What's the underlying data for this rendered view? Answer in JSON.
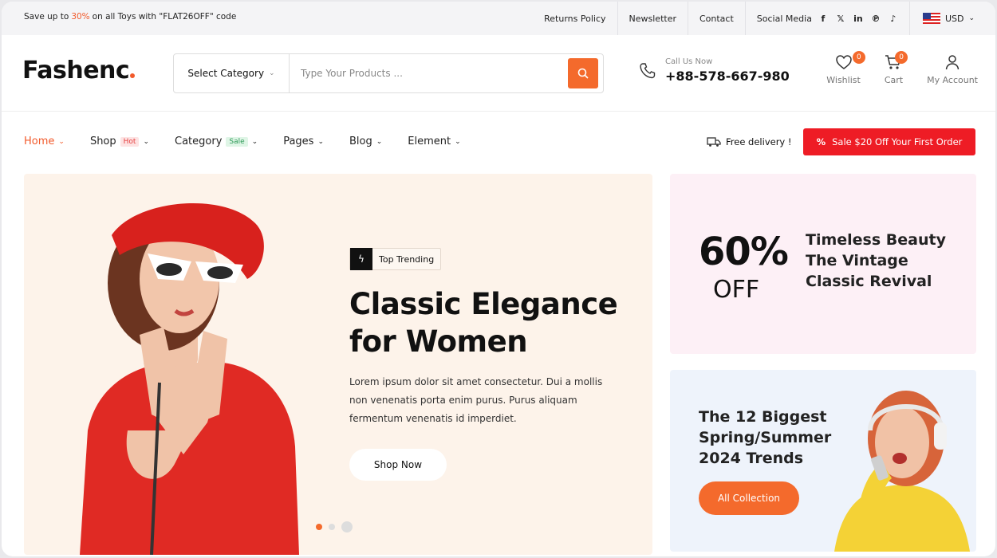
{
  "topbar": {
    "promo_before": "Save up to",
    "promo_pct": "30%",
    "promo_after": "on all Toys with \"FLAT26OFF\" code",
    "links": [
      "Returns Policy",
      "Newsletter",
      "Contact"
    ],
    "social_label": "Social Media",
    "social_icons": [
      "facebook-icon",
      "x-icon",
      "linkedin-icon",
      "pinterest-icon",
      "tiktok-icon"
    ],
    "currency": "USD"
  },
  "header": {
    "logo": "Fashenc",
    "category_label": "Select Category",
    "search_placeholder": "Type Your Products ...",
    "call_label": "Call Us Now",
    "call_number": "+88-578-667-980",
    "wishlist_label": "Wishlist",
    "wishlist_count": "0",
    "cart_label": "Cart",
    "cart_count": "0",
    "account_label": "My Account"
  },
  "nav": {
    "items": [
      {
        "label": "Home",
        "tag": ""
      },
      {
        "label": "Shop",
        "tag": "Hot"
      },
      {
        "label": "Category",
        "tag": "Sale"
      },
      {
        "label": "Pages",
        "tag": ""
      },
      {
        "label": "Blog",
        "tag": ""
      },
      {
        "label": "Element",
        "tag": ""
      }
    ],
    "delivery": "Free delivery !",
    "sale_button": "Sale $20 Off Your First Order"
  },
  "hero": {
    "badge": "Top Trending",
    "title": "Classic Elegance for Women",
    "description": "Lorem ipsum dolor sit amet consectetur. Dui a mollis non venenatis porta enim purus. Purus aliquam fermentum venenatis id imperdiet.",
    "button": "Shop Now"
  },
  "banner1": {
    "percent": "60%",
    "off": "OFF",
    "text": "Timeless Beauty The Vintage Classic Revival"
  },
  "banner2": {
    "text": "The 12 Biggest Spring/Summer 2024 Trends",
    "button": "All Collection"
  },
  "colors": {
    "accent": "#f46a2c",
    "sale_red": "#ee1c25",
    "hero_bg": "#fdf3ea",
    "banner1_bg": "#fdf0f6",
    "banner2_bg": "#eef3fb"
  }
}
